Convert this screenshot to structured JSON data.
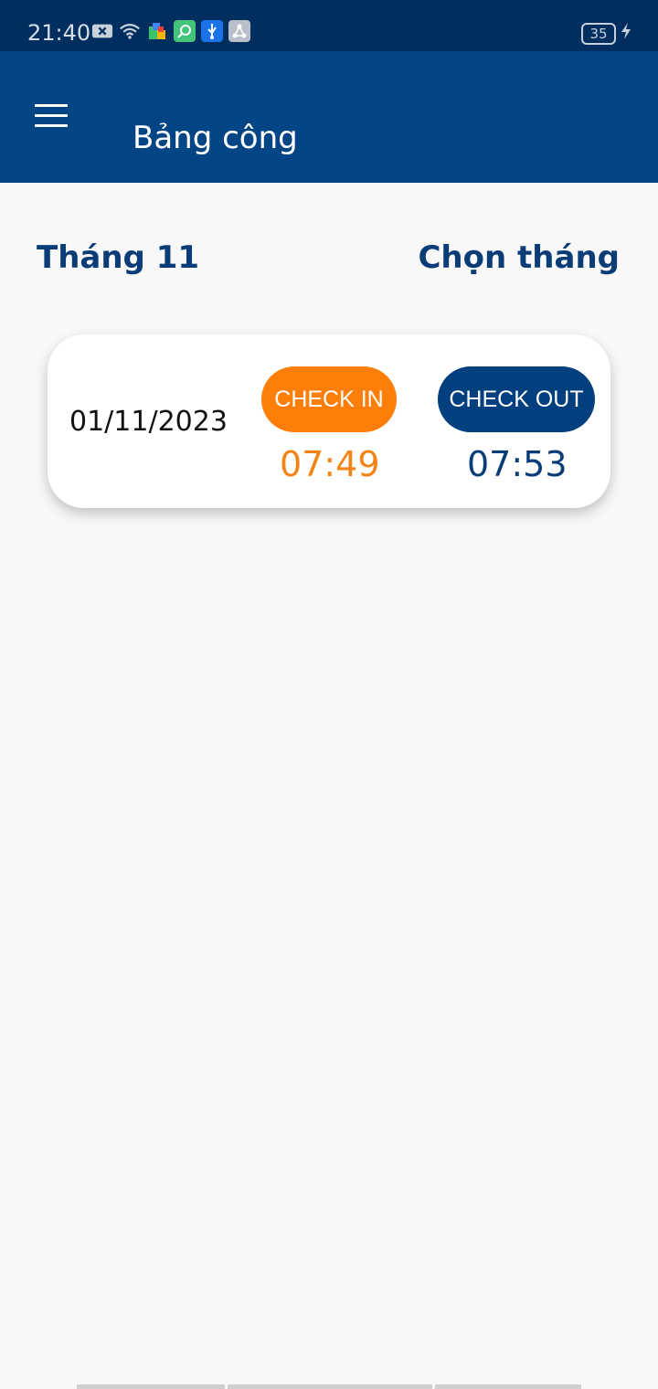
{
  "status_bar": {
    "time": "21:40",
    "battery_level": "35",
    "icons": [
      "camera-x-icon",
      "wifi-icon",
      "puzzle-icon",
      "search-app-icon",
      "usb-icon",
      "share-icon",
      "charging-icon"
    ]
  },
  "app_bar": {
    "title": "Bảng công",
    "menu_icon": "hamburger-menu-icon"
  },
  "month_header": {
    "current_month": "Tháng 11",
    "pick_month_label": "Chọn tháng"
  },
  "attendance": [
    {
      "date": "01/11/2023",
      "check_in_label": "CHECK IN",
      "check_in_time": "07:49",
      "check_out_label": "CHECK OUT",
      "check_out_time": "07:53"
    }
  ],
  "colors": {
    "primary": "#024585",
    "status_bar": "#002f5f",
    "accent_orange": "#fd7f0a",
    "background": "#f8f8f8"
  }
}
